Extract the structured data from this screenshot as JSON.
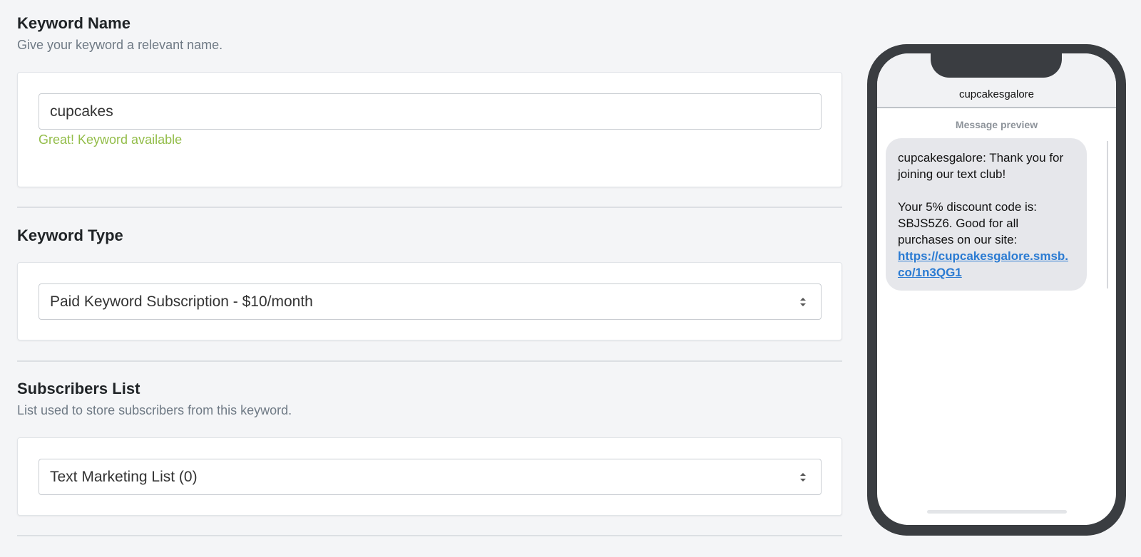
{
  "keyword_name": {
    "title": "Keyword Name",
    "description": "Give your keyword a relevant name.",
    "value": "cupcakes",
    "status": "Great! Keyword available",
    "status_color": "#93bd49"
  },
  "keyword_type": {
    "title": "Keyword Type",
    "selected": "Paid Keyword Subscription - $10/month"
  },
  "subscribers_list": {
    "title": "Subscribers List",
    "description": "List used to store subscribers from this keyword.",
    "selected": "Text Marketing List (0)"
  },
  "phone_preview": {
    "sender": "cupcakesgalore",
    "preview_label": "Message preview",
    "message_line1": "cupcakesgalore: Thank you for joining our text club!",
    "message_line2": "Your 5% discount code is: SBJS5Z6. Good for all purchases on our site:",
    "message_link": "https://cupcakesgalore.smsb.co/1n3QG1",
    "link_color": "#2b7bd2"
  }
}
